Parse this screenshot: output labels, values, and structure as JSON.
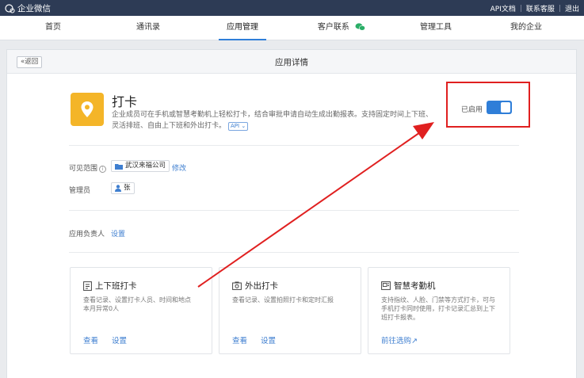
{
  "topbar": {
    "logo_text": "企业微信",
    "links": [
      "API文档",
      "联系客服",
      "退出"
    ],
    "separator": "|"
  },
  "nav": {
    "items": [
      {
        "label": "首页"
      },
      {
        "label": "通讯录"
      },
      {
        "label": "应用管理",
        "active": true
      },
      {
        "label": "客户联系"
      },
      {
        "label": "管理工具"
      },
      {
        "label": "我的企业"
      }
    ]
  },
  "panel": {
    "back_label": "«返回",
    "title": "应用详情"
  },
  "app": {
    "name": "打卡",
    "description": "企业成员可在手机或智慧考勤机上轻松打卡，结合审批申请自动生成出勤报表。支持固定时间上下班、灵活排班、自由上下班和外出打卡。",
    "api_badge": "API ⌄",
    "status_label": "已启用",
    "enabled": true,
    "icon_color": "#f4b528"
  },
  "visibility": {
    "label": "可见范围",
    "info_glyph": "i",
    "dept": "武汉来福公司",
    "edit": "修改"
  },
  "admin": {
    "label": "管理员",
    "name": "张"
  },
  "owner": {
    "label": "应用负责人",
    "setting": "设置"
  },
  "cards": [
    {
      "title": "上下班打卡",
      "desc_line1": "查看记录、设置打卡人员、时间和地点",
      "desc_line2": "本月异常0人",
      "desc_line3": "",
      "link1": "查看",
      "link2": "设置"
    },
    {
      "title": "外出打卡",
      "desc_line1": "查看记录、设置拍照打卡和定时汇报",
      "desc_line2": "",
      "desc_line3": "",
      "link1": "查看",
      "link2": "设置"
    },
    {
      "title": "智慧考勤机",
      "desc_line1": "支持指纹、人脸、门禁等方式打卡，可与",
      "desc_line2": "手机打卡同时使用，打卡记录汇总到上下",
      "desc_line3": "班打卡报表。",
      "link1": "前往选购↗",
      "link2": ""
    }
  ],
  "colors": {
    "topbar_bg": "#2d3b55",
    "accent": "#2f7ed8",
    "annotation_red": "#e02020"
  }
}
